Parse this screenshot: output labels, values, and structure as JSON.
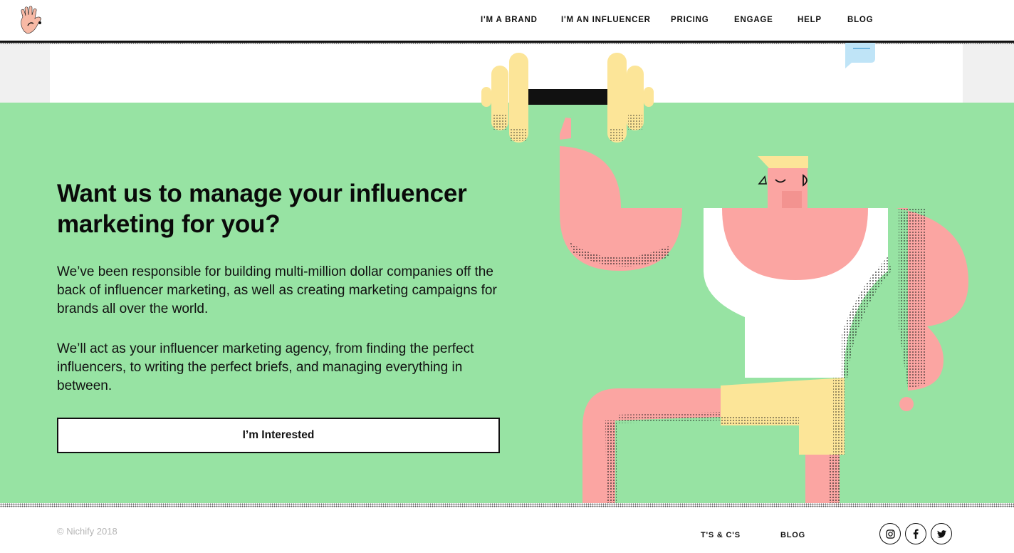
{
  "header": {
    "logo_icon": "waving-hand-logo-icon",
    "nav": [
      {
        "label": "I'M A BRAND"
      },
      {
        "label": "I'M AN INFLUENCER"
      },
      {
        "label": "PRICING"
      },
      {
        "label": "ENGAGE"
      },
      {
        "label": "HELP"
      },
      {
        "label": "BLOG"
      }
    ]
  },
  "hero": {
    "headline": "Want us to manage your influencer marketing for you?",
    "paragraph1": "We’ve been responsible for building multi-million dollar companies off the back of influencer marketing, as well as creating marketing campaigns for brands all over the world.",
    "paragraph2": "We’ll act as your influencer marketing agency, from finding the perfect influencers, to writing the perfect briefs, and managing everything in between.",
    "cta_label": "I’m Interested",
    "illustration_icon": "weightlifter-illustration"
  },
  "footer": {
    "copyright": "© Nichify 2018",
    "links": [
      {
        "label": "T'S & C'S"
      },
      {
        "label": "BLOG"
      }
    ],
    "social": [
      {
        "icon": "instagram-icon"
      },
      {
        "icon": "facebook-icon"
      },
      {
        "icon": "twitter-icon"
      }
    ]
  },
  "colors": {
    "green_bg": "#97e3a3",
    "skin": "#fba5a2",
    "shorts": "#fce598",
    "text": "#111111",
    "footer_grey": "#b5b5b5"
  }
}
